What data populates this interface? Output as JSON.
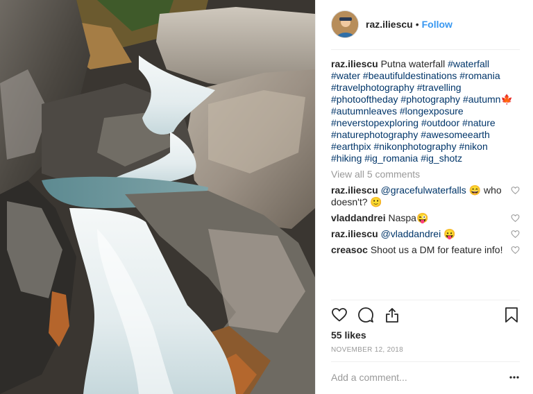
{
  "post": {
    "username": "raz.iliescu",
    "follow_label": "Follow",
    "dot": "•"
  },
  "caption": {
    "username": "raz.iliescu",
    "text": "Putna waterfall",
    "hashtags_line1": [
      "#waterfall",
      "#water"
    ],
    "hashtags_line2": [
      "#beautifuldestinations",
      "#romania"
    ],
    "hashtags_line3": [
      "#travelphotography",
      "#travelling"
    ],
    "hashtags_line4": [
      "#photooftheday",
      "#photography",
      "#autumn"
    ],
    "autumn_emoji": "🍁",
    "hashtags_line5": [
      "#autumnleaves",
      "#longexposure"
    ],
    "hashtags_line6": [
      "#neverstopexploring",
      "#outdoor",
      "#nature"
    ],
    "hashtags_line7": [
      "#naturephotography",
      "#awesomeearth"
    ],
    "hashtags_line8": [
      "#earthpix",
      "#nikonphotography",
      "#nikon"
    ],
    "hashtags_line9": [
      "#hiking",
      "#ig_romania",
      "#ig_shotz"
    ]
  },
  "view_all_comments": "View all 5 comments",
  "comments": [
    {
      "username": "raz.iliescu",
      "mention": "@gracefulwaterfalls",
      "text_before": "",
      "text_after": "😄  who doesn't? 🙂"
    },
    {
      "username": "vladdandrei",
      "mention": "",
      "text_before": "Naspa😜",
      "text_after": ""
    },
    {
      "username": "raz.iliescu",
      "mention": "@vladdandrei",
      "text_before": "",
      "text_after": "😛"
    },
    {
      "username": "creasoc",
      "mention": "",
      "text_before": "Shoot us a DM for feature info!",
      "text_after": ""
    }
  ],
  "likes": "55 likes",
  "date": "NOVEMBER 12, 2018",
  "add_comment_placeholder": "Add a comment...",
  "icons": {
    "like": "heart-icon",
    "comment": "comment-icon",
    "share": "share-icon",
    "save": "bookmark-icon",
    "more": "more-options-icon",
    "comment_like": "heart-icon"
  },
  "colors": {
    "link": "#003569",
    "follow": "#3897f0",
    "muted": "#999999",
    "text": "#262626"
  }
}
